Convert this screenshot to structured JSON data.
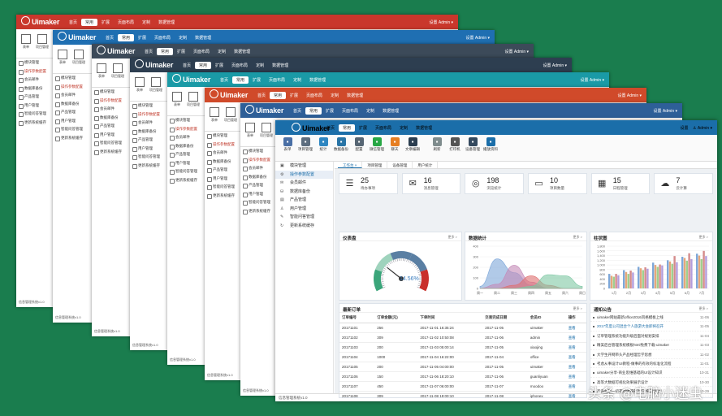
{
  "app": {
    "brand": "Uimaker",
    "footer": "信息管理系统v1.0",
    "settings": "设置",
    "user": "Admin ▾"
  },
  "nav": [
    "首页",
    "常用",
    "扩展",
    "页面布局",
    "定制",
    "数据管理"
  ],
  "colors": {
    "layers": [
      "#c9372c",
      "#1f6fb2",
      "#3c4a59",
      "#2d3e50",
      "#1a9aa6",
      "#d04a2a",
      "#2e5f98",
      "#1b6ea9"
    ],
    "accent": "#1b6ea9",
    "background": "#1a7d4e"
  },
  "bg_toolbar": [
    "表单",
    "项目管理"
  ],
  "bg_side": [
    "模块管理",
    "操作参数配置",
    "会员邮件",
    "数据库备份",
    "产品管理",
    "用户管理",
    "智能问答管理",
    "更新系统缓存"
  ],
  "toolbar": [
    {
      "label": "表单",
      "icon": "form-icon",
      "color": "#4a6fa5"
    },
    {
      "label": "项目管理",
      "icon": "project-icon",
      "color": "#5d6d7e"
    },
    {
      "label": "统计",
      "icon": "stats-icon",
      "color": "#2e86c1"
    },
    {
      "label": "数据备份",
      "icon": "backup-icon",
      "color": "#2874a6"
    },
    {
      "label": "配置",
      "icon": "config-icon",
      "color": "#566573"
    },
    {
      "label": "微信管理",
      "icon": "wechat-icon",
      "color": "#28a745"
    },
    {
      "label": "聊天",
      "icon": "chat-icon",
      "color": "#e67e22"
    },
    {
      "label": "文章编辑",
      "icon": "article-icon",
      "color": "#2c3e50"
    },
    {
      "label": "刷新",
      "icon": "refresh-icon",
      "color": "#7f8c8d"
    },
    {
      "label": "打印机",
      "icon": "printer-icon",
      "color": "#555"
    },
    {
      "label": "设备管理",
      "icon": "device-icon",
      "color": "#34495e"
    },
    {
      "label": "播放资料",
      "icon": "play-icon",
      "color": "#1b6ea9"
    }
  ],
  "side": [
    "模块管理",
    "操作参数配置",
    "会员邮件",
    "数据库备份",
    "产品管理",
    "用户管理",
    "智能问答管理",
    "更新系统缓存"
  ],
  "tabs": [
    "工作台 ×",
    "项目管理",
    "设备管理",
    "用户统计"
  ],
  "stats": [
    {
      "num": "25",
      "label": "待办事项",
      "icon": "todo-icon",
      "glyph": "☰"
    },
    {
      "num": "16",
      "label": "消息管理",
      "icon": "mail-icon",
      "glyph": "✉"
    },
    {
      "num": "198",
      "label": "浏览统计",
      "icon": "view-icon",
      "glyph": "◎"
    },
    {
      "num": "10",
      "label": "项目数量",
      "icon": "project-count-icon",
      "glyph": "▭"
    },
    {
      "num": "15",
      "label": "日程管理",
      "icon": "calendar-icon",
      "glyph": "▦"
    },
    {
      "num": "7",
      "label": "云计算",
      "icon": "cloud-icon",
      "glyph": "☁"
    }
  ],
  "panels": {
    "gauge": "仪表盘",
    "area": "数据统计",
    "bar": "柱状图",
    "orders": "最新订单",
    "notice": "通知公告",
    "more": "更多 >"
  },
  "gauge": {
    "value": "14.56%",
    "fraction": 0.28
  },
  "area_chart": {
    "type": "area",
    "x": [
      "周一",
      "周二",
      "周三",
      "周四",
      "周五",
      "周六",
      "周日"
    ],
    "ylim": [
      0,
      400
    ],
    "yticks": [
      "400",
      "300",
      "200",
      "100",
      "0"
    ],
    "series": [
      {
        "values": [
          20,
          280,
          150,
          30,
          0,
          0,
          0
        ],
        "color": "#7da7d9"
      },
      {
        "values": [
          0,
          40,
          220,
          60,
          0,
          0,
          0
        ],
        "color": "#c48ab8"
      },
      {
        "values": [
          0,
          0,
          30,
          120,
          30,
          0,
          0
        ],
        "color": "#e07070"
      },
      {
        "values": [
          0,
          0,
          0,
          20,
          130,
          120,
          20
        ],
        "color": "#7ec8a4"
      }
    ]
  },
  "bar_chart": {
    "type": "bar",
    "categories": [
      "1月",
      "2月",
      "3月",
      "4月",
      "5月",
      "6月",
      "7月"
    ],
    "ylim": [
      0,
      1800
    ],
    "yticks": [
      "1,800",
      "1,600",
      "1,400",
      "1,200",
      "1,000",
      "800",
      "600",
      "400",
      "200",
      "0"
    ],
    "series": [
      {
        "values": [
          620,
          780,
          920,
          1100,
          1200,
          1350,
          1480
        ],
        "color": "#7da7d9"
      },
      {
        "values": [
          540,
          700,
          860,
          1000,
          1150,
          1300,
          1400
        ],
        "color": "#e6a77a"
      },
      {
        "values": [
          500,
          620,
          780,
          920,
          1050,
          1180,
          1250
        ],
        "color": "#9fcf8f"
      },
      {
        "values": [
          620,
          760,
          900,
          1020,
          1380,
          1500,
          1600
        ],
        "color": "#d48b8b"
      },
      {
        "values": [
          560,
          680,
          840,
          980,
          1120,
          1250,
          1380
        ],
        "color": "#b39ddb"
      }
    ]
  },
  "orders": {
    "headers": [
      "订单编号",
      "订单金额(元)",
      "下单时间",
      "交易完成日期",
      "会员ID",
      "操作"
    ],
    "rows": [
      [
        "20171101",
        "256",
        "2017-11-01 16:35:24",
        "2017-11-05",
        "uimaker",
        "查看"
      ],
      [
        "20171102",
        "309",
        "2017-11-02 10:50:08",
        "2017-11-06",
        "admin",
        "查看"
      ],
      [
        "20171103",
        "200",
        "2017-11-03 05:00:14",
        "2017-11-05",
        "xiaojing",
        "查看"
      ],
      [
        "20171104",
        "1000",
        "2017-11-04 16:22:00",
        "2017-11-04",
        "office",
        "查看"
      ],
      [
        "20171105",
        "200",
        "2017-11-05 04:00:00",
        "2017-11-05",
        "uimaker",
        "查看"
      ],
      [
        "20171106",
        "150",
        "2017-11-06 18:20:10",
        "2017-11-06",
        "guanliyuan",
        "查看"
      ],
      [
        "20171107",
        "450",
        "2017-11-07 06:00:00",
        "2017-11-07",
        "moodoo",
        "查看"
      ],
      [
        "20171108",
        "309",
        "2017-11-08 19:00:10",
        "2017-11-08",
        "iphonex",
        "查看"
      ]
    ]
  },
  "notices": [
    {
      "text": "uimaker网站最新office2016风格模板上线",
      "date": "11-06"
    },
    {
      "text": "2017年度公司混合个人旅游大会即将召开",
      "date": "11-05",
      "hl": true
    },
    {
      "text": "订单管理系统功能升级后面对规划安排",
      "date": "11-04"
    },
    {
      "text": "精美后台管理系统模板html免费下载-uimaker",
      "date": "11-03"
    },
    {
      "text": "大学生开网带头产品经理哲学思想",
      "date": "11-02"
    },
    {
      "text": "考虑从事设计UI教程-做事的有效的标准化流程",
      "date": "11-01"
    },
    {
      "text": "uimaker分享-商业思维基础的UI设计知识",
      "date": "10-31"
    },
    {
      "text": "高等大数据可视化效果展示设计",
      "date": "10-30"
    },
    {
      "text": "严谨规划一初夜想便细的对与·细问道理！",
      "date": "10-29"
    }
  ],
  "watermark": "头条 @电脑小迷虫"
}
